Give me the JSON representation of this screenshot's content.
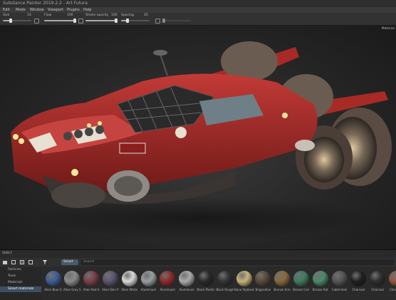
{
  "app": {
    "title": "Substance Painter 2019.2.2 - Art Futura"
  },
  "menu": [
    "Edit",
    "Mode",
    "Window",
    "Viewport",
    "Plugins",
    "Help"
  ],
  "toolbar": {
    "size_label": "Size",
    "size_value": "33",
    "flow_label": "Flow",
    "flow_value": "100",
    "stroke_opacity_label": "Stroke opacity",
    "stroke_opacity_value": "100",
    "spacing_label": "Spacing",
    "spacing_value": "20"
  },
  "viewport": {
    "label": "Material"
  },
  "shelf": {
    "title": "SHELF",
    "filter": "Smart",
    "search_placeholder": "Search",
    "categories": [
      {
        "label": "Particles",
        "active": false
      },
      {
        "label": "Tools",
        "active": false
      },
      {
        "label": "Materials",
        "active": false
      },
      {
        "label": "Smart materials",
        "active": true
      }
    ],
    "materials": [
      {
        "name": "Alien Blue G",
        "color": "#3f5f94"
      },
      {
        "name": "Alien Grey S",
        "color": "#8a8a8a"
      },
      {
        "name": "Alien Red S",
        "color": "#7a4048"
      },
      {
        "name": "Alien Skin P",
        "color": "#5a5670"
      },
      {
        "name": "Alien White",
        "color": "#dadada"
      },
      {
        "name": "Aluminium",
        "color": "#9a9ea2"
      },
      {
        "name": "Aluminium",
        "color": "#8f2a2a"
      },
      {
        "name": "Aluminium",
        "color": "#aaaaaa"
      },
      {
        "name": "Black Plastic",
        "color": "#2a2a2a"
      },
      {
        "name": "Black Rough",
        "color": "#333333"
      },
      {
        "name": "Bone Stylized",
        "color": "#c8b27a"
      },
      {
        "name": "Brigandine",
        "color": "#5a4a3a"
      },
      {
        "name": "Bronze Arm",
        "color": "#8a6a3a"
      },
      {
        "name": "Bronze Corr",
        "color": "#3f7a5f"
      },
      {
        "name": "Bronze Rat",
        "color": "#4a8a6a"
      },
      {
        "name": "Cable Hole",
        "color": "#555555"
      },
      {
        "name": "Charcoal",
        "color": "#202020"
      },
      {
        "name": "Charcoal",
        "color": "#2e2e2e"
      },
      {
        "name": "Chocolate",
        "color": "#8a5a3a"
      }
    ]
  }
}
